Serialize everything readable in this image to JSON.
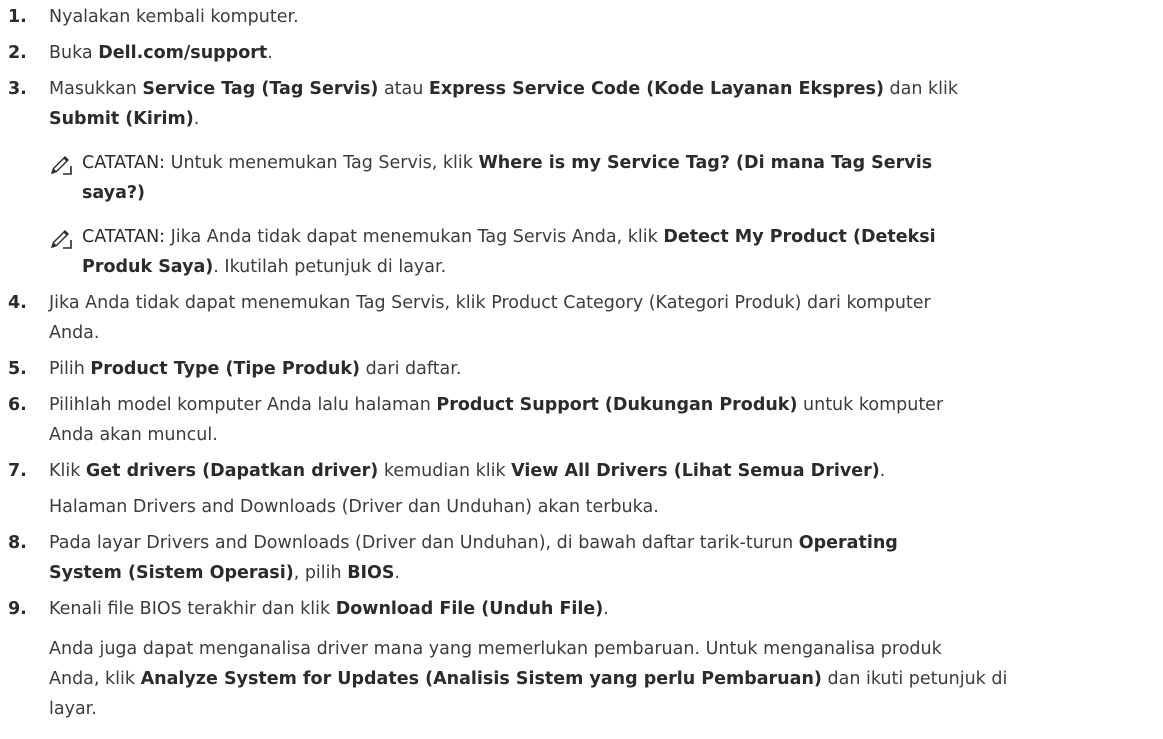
{
  "steps": [
    {
      "num": "1.",
      "text": "Nyalakan kembali komputer."
    },
    {
      "num": "2.",
      "pre": "Buka ",
      "b1": "Dell.com/support",
      "post": "."
    },
    {
      "num": "3.",
      "pre": "Masukkan ",
      "b1": "Service Tag (Tag Servis)",
      "mid1": " atau ",
      "b2": "Express Service Code (Kode Layanan Ekspres)",
      "mid2": " dan klik",
      "b3": "Submit (Kirim)",
      "post": "."
    },
    {
      "num": "4.",
      "line1": "Jika Anda tidak dapat menemukan Tag Servis, klik Product Category (Kategori Produk) dari komputer",
      "line2": "Anda."
    },
    {
      "num": "5.",
      "pre": "Pilih ",
      "b1": "Product Type (Tipe Produk)",
      "post": " dari daftar."
    },
    {
      "num": "6.",
      "pre": "Pilihlah model komputer Anda lalu halaman ",
      "b1": "Product Support (Dukungan Produk)",
      "post": " untuk komputer",
      "line2": "Anda akan muncul."
    },
    {
      "num": "7.",
      "pre": "Klik ",
      "b1": "Get drivers (Dapatkan driver)",
      "mid1": " kemudian klik ",
      "b2": "View All Drivers (Lihat Semua Driver)",
      "post": ".",
      "sub": "Halaman Drivers and Downloads (Driver dan Unduhan) akan terbuka."
    },
    {
      "num": "8.",
      "pre": "Pada layar Drivers and Downloads (Driver dan Unduhan), di bawah daftar tarik-turun ",
      "b1": "Operating",
      "b1b": "System (Sistem Operasi)",
      "mid1": ", pilih ",
      "b2": "BIOS",
      "post": "."
    },
    {
      "num": "9.",
      "pre": "Kenali file BIOS terakhir dan klik ",
      "b1": "Download File (Unduh File)",
      "post": ".",
      "sub1": "Anda juga dapat menganalisa driver mana yang memerlukan pembaruan. Untuk menganalisa produk",
      "sub2pre": "Anda, klik ",
      "sub2b": "Analyze System for Updates (Analisis Sistem yang perlu Pembaruan)",
      "sub2post": " dan ikuti petunjuk di",
      "sub3": "layar."
    }
  ],
  "notes": [
    {
      "label": "CATATAN:",
      "pre": " Untuk menemukan Tag Servis, klik ",
      "b1": "Where is my Service Tag? (Di mana Tag Servis",
      "b1b": "saya?)"
    },
    {
      "label": "CATATAN:",
      "pre": " Jika Anda tidak dapat menemukan Tag Servis Anda, klik ",
      "b1": "Detect My Product (Deteksi",
      "b1b": "Produk Saya)",
      "post": ". Ikutilah petunjuk di layar."
    }
  ],
  "icons": {
    "note": "pencil-note-icon"
  }
}
